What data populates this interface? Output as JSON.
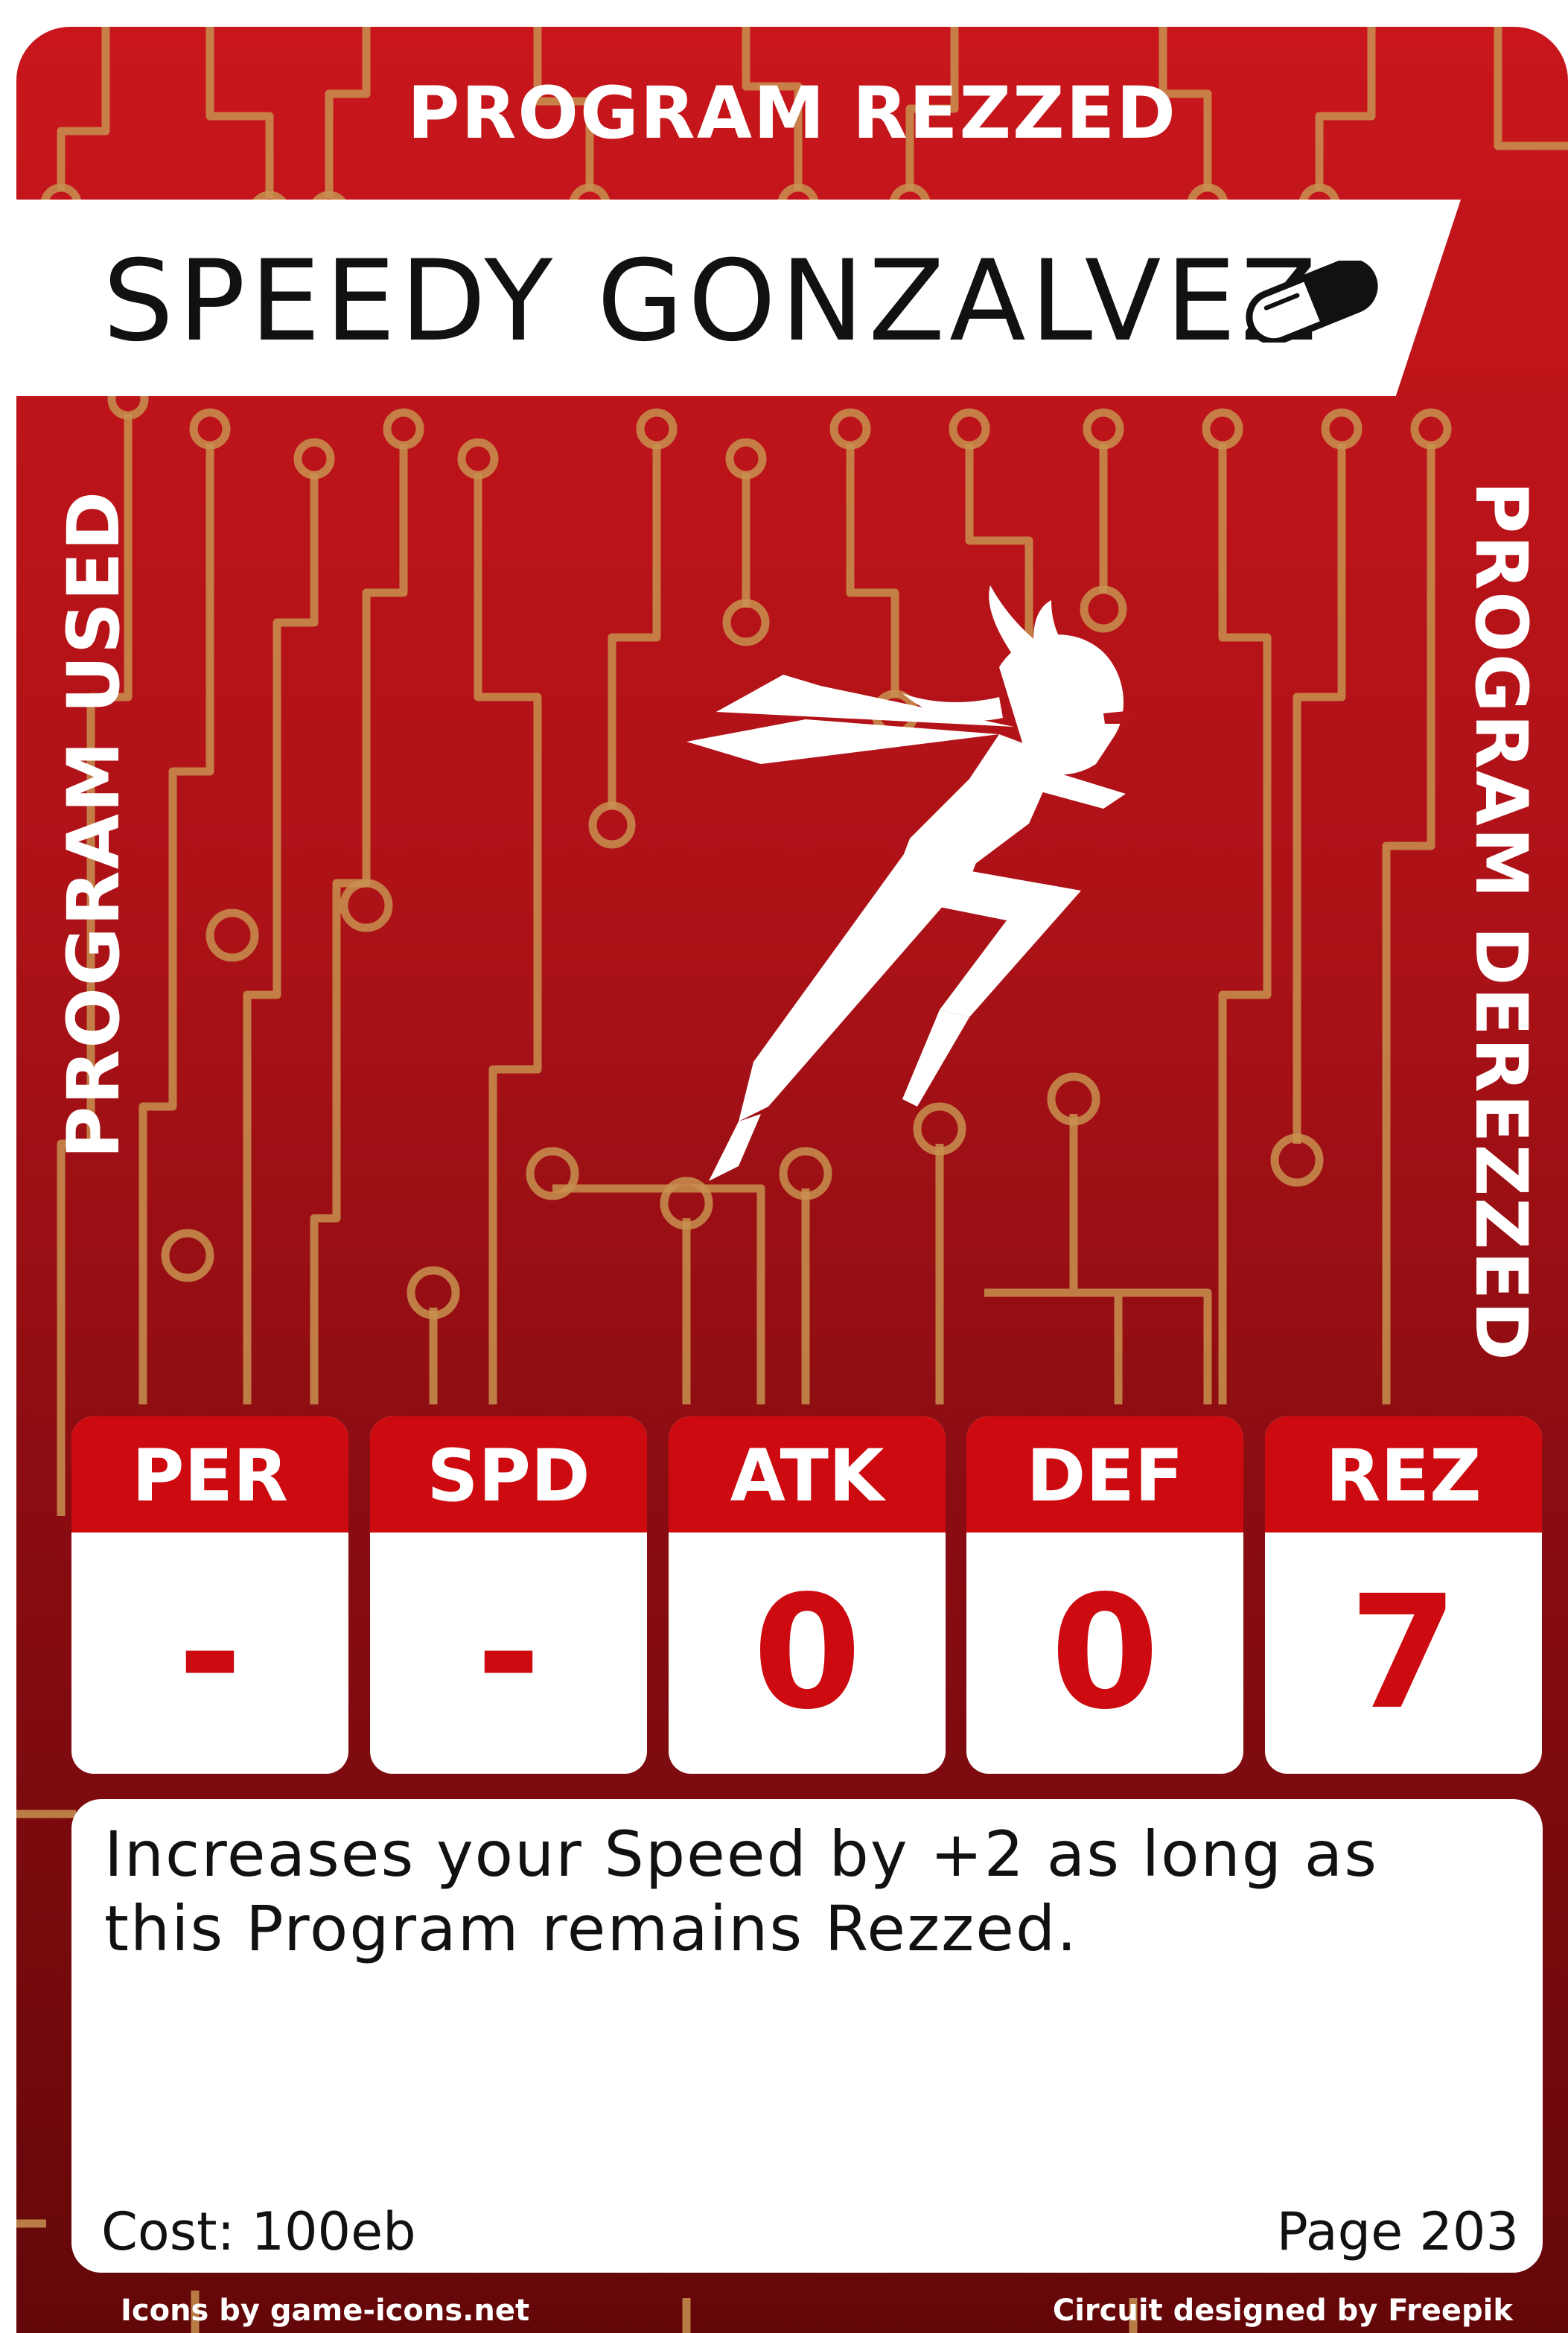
{
  "card": {
    "top_label": "PROGRAM REZZED",
    "name": "SPEEDY GONZALVEZ",
    "name_icon": "pill-capsule-icon",
    "left_label": "PROGRAM USED",
    "right_label": "PROGRAM DEREZZED",
    "illustration": "leaping-ninja-figure",
    "colors": {
      "card_red": "#b5141a",
      "stat_header_red": "#cc0a10",
      "circuit_gold": "#c8914f"
    }
  },
  "stats": [
    {
      "label": "PER",
      "value": "-"
    },
    {
      "label": "SPD",
      "value": "-"
    },
    {
      "label": "ATK",
      "value": "0"
    },
    {
      "label": "DEF",
      "value": "0"
    },
    {
      "label": "REZ",
      "value": "7"
    }
  ],
  "rules": {
    "text": "Increases your Speed by +2 as long as this Program remains Rezzed.",
    "cost": "Cost: 100eb",
    "page": "Page 203"
  },
  "credits": {
    "left": "Icons by game-icons.net",
    "right": "Circuit designed by Freepik"
  }
}
